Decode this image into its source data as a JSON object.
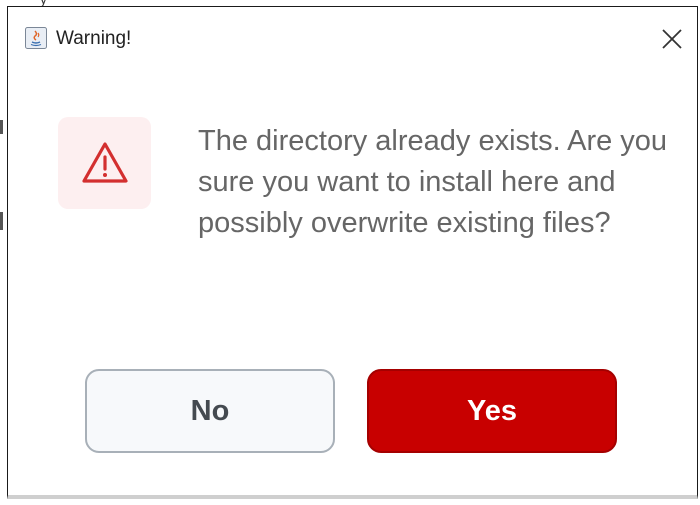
{
  "window": {
    "title": "Warning!",
    "app_icon": "java-app-icon",
    "close_icon": "close-icon"
  },
  "dialog": {
    "icon": "warning-triangle-icon",
    "message": "The directory already exists. Are you sure you want to install here and possibly overwrite existing files?",
    "buttons": {
      "no_label": "No",
      "yes_label": "Yes"
    }
  },
  "colors": {
    "accent_red": "#c80000",
    "icon_red": "#d32f2f",
    "warn_tile_bg": "#fdeff0",
    "secondary_button_bg": "#f7f9fb",
    "message_text": "#666666"
  }
}
